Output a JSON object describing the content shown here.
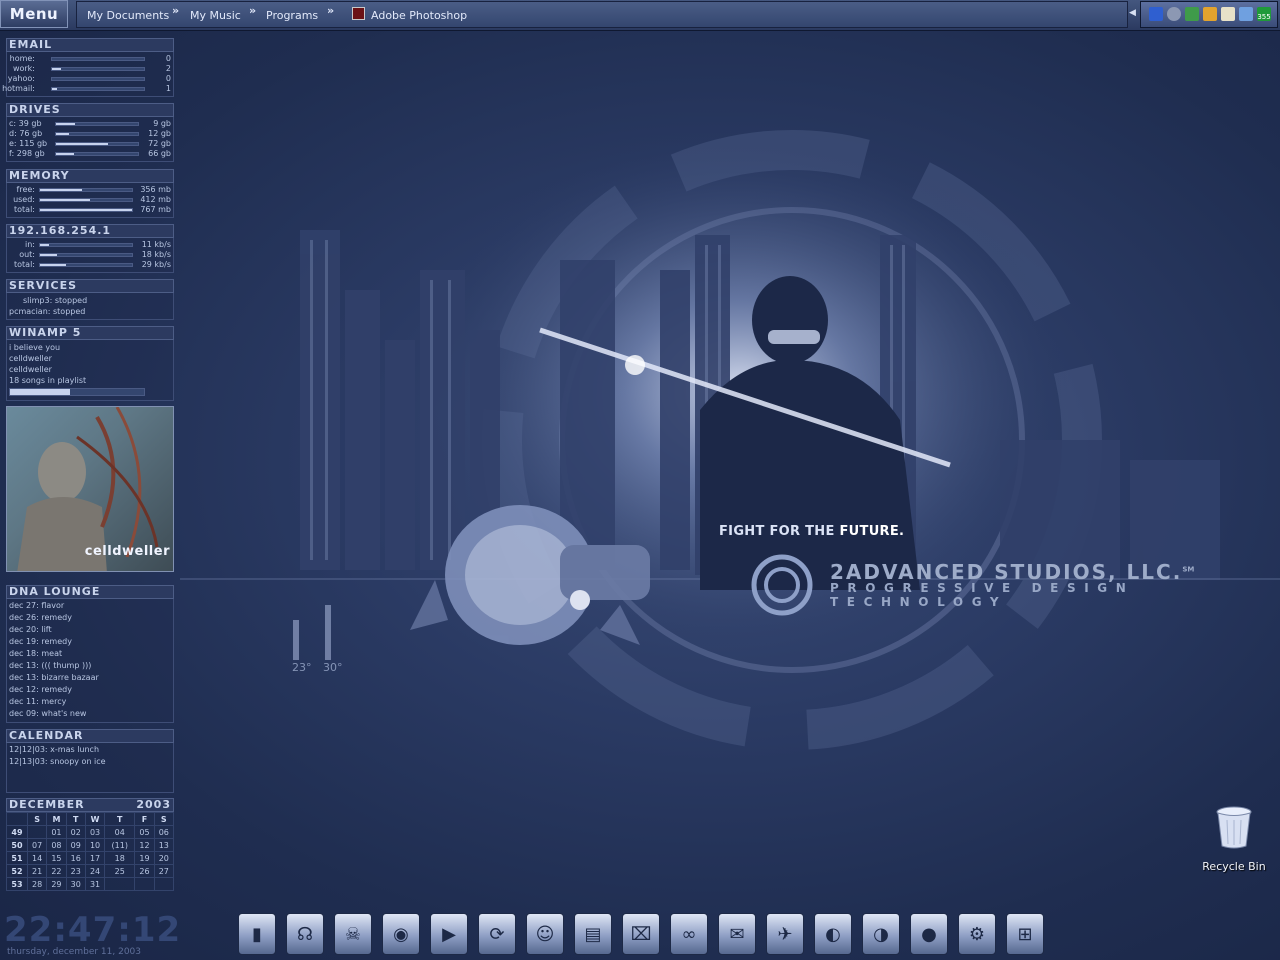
{
  "taskbar": {
    "menu_label": "Menu",
    "quick_links": [
      "My Documents",
      "My Music",
      "Programs"
    ],
    "chevron": "»",
    "active_task": "Adobe Photoshop",
    "tray_badge": "355"
  },
  "email": {
    "title": "EMAIL",
    "rows": [
      {
        "label": "home:",
        "value": "0",
        "fill": 0.0
      },
      {
        "label": "work:",
        "value": "2",
        "fill": 0.1
      },
      {
        "label": "yahoo:",
        "value": "0",
        "fill": 0.0
      },
      {
        "label": "hotmail:",
        "value": "1",
        "fill": 0.05
      }
    ]
  },
  "drives": {
    "title": "DRIVES",
    "rows": [
      {
        "label": "c:  39 gb",
        "value": "9 gb",
        "fill": 0.23
      },
      {
        "label": "d:  76 gb",
        "value": "12 gb",
        "fill": 0.16
      },
      {
        "label": "e:  115 gb",
        "value": "72 gb",
        "fill": 0.63
      },
      {
        "label": "f: 298 gb",
        "value": "66 gb",
        "fill": 0.22
      }
    ]
  },
  "memory": {
    "title": "MEMORY",
    "rows": [
      {
        "label": "free:",
        "value": "356 mb",
        "fill": 0.46
      },
      {
        "label": "used:",
        "value": "412 mb",
        "fill": 0.54
      },
      {
        "label": "total:",
        "value": "767 mb",
        "fill": 1.0
      }
    ]
  },
  "network": {
    "title": "192.168.254.1",
    "rows": [
      {
        "label": "in:",
        "value": "11 kb/s",
        "fill": 0.1
      },
      {
        "label": "out:",
        "value": "18 kb/s",
        "fill": 0.18
      },
      {
        "label": "total:",
        "value": "29 kb/s",
        "fill": 0.28
      }
    ]
  },
  "services": {
    "title": "SERVICES",
    "lines": [
      "slimp3:  stopped",
      "pcmacian:  stopped"
    ]
  },
  "winamp": {
    "title": "WINAMP 5",
    "lines": [
      "i believe you",
      "celldweller",
      "celldweller",
      "18 songs in playlist"
    ],
    "progress": 0.45
  },
  "album": {
    "text": "celldweller"
  },
  "dna_lounge": {
    "title": "DNA LOUNGE",
    "events": [
      "dec 27: flavor",
      "dec 26: remedy",
      "dec 20: lift",
      "dec 19: remedy",
      "dec 18: meat",
      "dec 13: ((( thump )))",
      "dec 13: bizarre bazaar",
      "dec 12: remedy",
      "dec 11: mercy",
      "dec 09: what's new"
    ]
  },
  "calendar_events": {
    "title": "CALENDAR",
    "lines": [
      "12|12|03: x-mas lunch",
      "12|13|03: snoopy on ice"
    ]
  },
  "month_calendar": {
    "month": "DECEMBER",
    "year": "2003",
    "days_of_week": [
      "S",
      "M",
      "T",
      "W",
      "T",
      "F",
      "S"
    ],
    "weeks": [
      {
        "num": "49",
        "days": [
          "",
          "01",
          "02",
          "03",
          "04",
          "05",
          "06"
        ]
      },
      {
        "num": "50",
        "days": [
          "07",
          "08",
          "09",
          "10",
          "(11)",
          "12",
          "13"
        ]
      },
      {
        "num": "51",
        "days": [
          "14",
          "15",
          "16",
          "17",
          "18",
          "19",
          "20"
        ]
      },
      {
        "num": "52",
        "days": [
          "21",
          "22",
          "23",
          "24",
          "25",
          "26",
          "27"
        ]
      },
      {
        "num": "53",
        "days": [
          "28",
          "29",
          "30",
          "31",
          "",
          "",
          ""
        ]
      }
    ]
  },
  "clock": {
    "time": "22:47:12",
    "date": "thursday, december 11, 2003"
  },
  "desktop": {
    "recycle_bin_label": "Recycle Bin"
  },
  "wallpaper": {
    "tagline_prefix": "FIGHT FOR THE ",
    "tagline_emphasis": "FUTURE.",
    "brand": "2ADVANCED STUDIOS, LLC.",
    "brand_sm": "SM",
    "motto": "PROGRESSIVE DESIGN TECHNOLOGY",
    "temp_left": "23°",
    "temp_right": "30°"
  },
  "dock_icons": [
    "tower-icon",
    "headphones-icon",
    "skull-icon",
    "disc-icon",
    "media-player-icon",
    "refresh-icon",
    "alien-icon",
    "document-icon",
    "computer-lock-icon",
    "goggles-icon",
    "mail-icon",
    "bird-icon",
    "globe-icon",
    "network-globe-icon",
    "apple-icon",
    "tools-icon",
    "windows-icon"
  ],
  "colors": {
    "background": "#25345a",
    "panel_header": "#2c3a60",
    "text": "#b8c6e2",
    "accent": "#c7d3ee"
  }
}
